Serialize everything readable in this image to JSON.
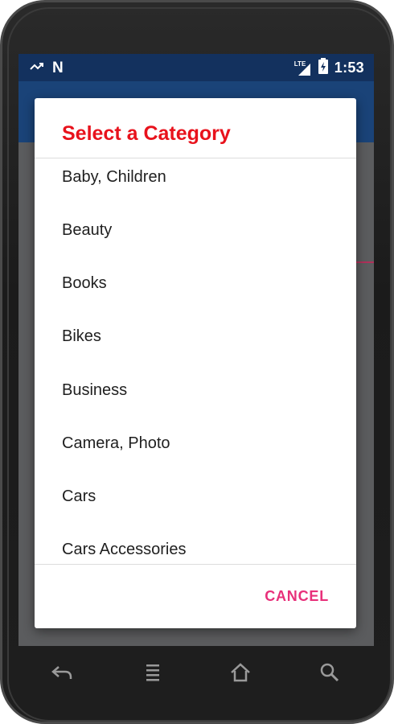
{
  "status_bar": {
    "time": "1:53",
    "network_label": "LTE",
    "notification_icon": "N"
  },
  "dialog": {
    "title": "Select a Category",
    "items": [
      "Baby, Children",
      "Beauty",
      "Books",
      "Bikes",
      "Business",
      "Camera, Photo",
      "Cars",
      "Cars Accessories"
    ],
    "cancel_label": "CANCEL"
  },
  "colors": {
    "title": "#e8121c",
    "cancel": "#e8307a",
    "status_bar": "#13315e",
    "app_bar": "#1a4378"
  },
  "nav_bar": {
    "icons": [
      "back-icon",
      "menu-icon",
      "home-icon",
      "search-icon"
    ]
  }
}
